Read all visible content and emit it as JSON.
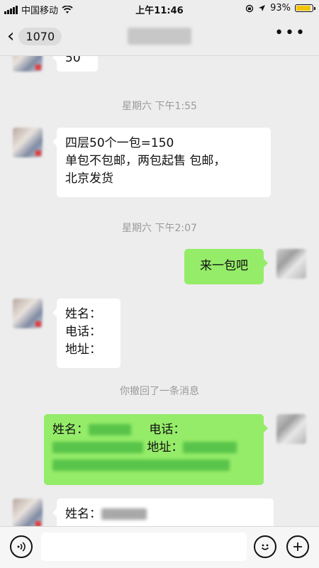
{
  "status_bar": {
    "carrier": "中国移动",
    "time": "上午11:46",
    "battery_percent": "93%",
    "battery_level": 0.93
  },
  "nav": {
    "unread_count": "1070",
    "more_label": "•••"
  },
  "messages": {
    "top_partial": "50",
    "timestamp_1": "星期六 下午1:55",
    "msg_1_line_1": "四层50个一包=150",
    "msg_1_line_2": "单包不包邮，两包起售 包邮，",
    "msg_1_line_3": "北京发货",
    "timestamp_2": "星期六 下午2:07",
    "msg_2": "来一包吧",
    "msg_3_line_1": "姓名：",
    "msg_3_line_2": "电话：",
    "msg_3_line_3": "地址：",
    "recall_notice": "你撤回了一条消息",
    "msg_4_name_label": "姓名：",
    "msg_4_phone_label": "电话：",
    "msg_4_address_label": "地址：",
    "msg_5_name_label": "姓名："
  },
  "input_bar": {
    "voice_icon": "voice-icon",
    "emoji_icon": "emoji-icon",
    "plus_icon": "plus-icon"
  },
  "colors": {
    "background": "#ededed",
    "outgoing_bubble": "#95ec69",
    "incoming_bubble": "#ffffff",
    "battery": "#f2c500"
  }
}
